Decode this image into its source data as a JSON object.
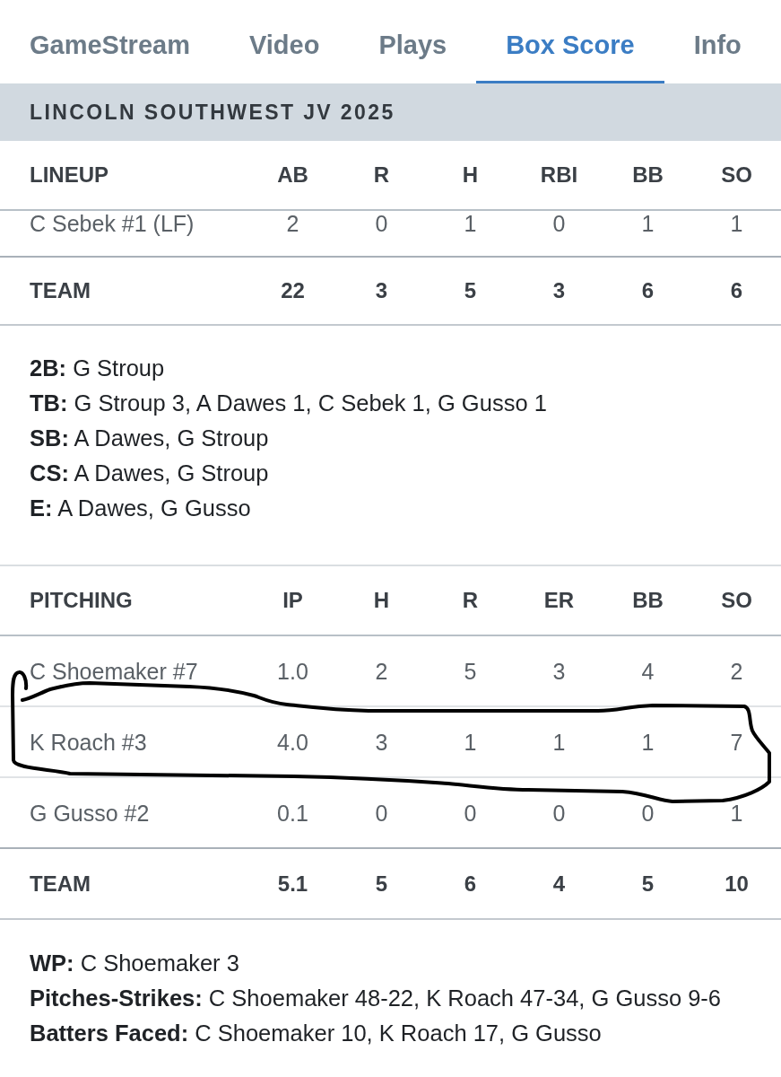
{
  "tabs": [
    {
      "label": "GameStream",
      "selected": false
    },
    {
      "label": "Video",
      "selected": false
    },
    {
      "label": "Plays",
      "selected": false
    },
    {
      "label": "Box Score",
      "selected": true
    },
    {
      "label": "Info",
      "selected": false
    }
  ],
  "team_header": "LINCOLN SOUTHWEST JV 2025",
  "lineup": {
    "columns": [
      "LINEUP",
      "AB",
      "R",
      "H",
      "RBI",
      "BB",
      "SO"
    ],
    "rows": [
      {
        "cells": [
          "C Sebek #1 (LF)",
          "2",
          "0",
          "1",
          "0",
          "1",
          "1"
        ]
      }
    ],
    "total": [
      "TEAM",
      "22",
      "3",
      "5",
      "3",
      "6",
      "6"
    ]
  },
  "batting_notes": [
    "**2B:** G Stroup",
    "**TB:** G Stroup 3, A Dawes 1, C Sebek 1, G Gusso 1",
    "**SB:** A Dawes, G Stroup",
    "**CS:** A Dawes, G Stroup",
    "**E:** A Dawes, G Gusso"
  ],
  "pitching": {
    "columns": [
      "PITCHING",
      "IP",
      "H",
      "R",
      "ER",
      "BB",
      "SO"
    ],
    "rows": [
      {
        "cells": [
          "C Shoemaker #7",
          "1.0",
          "2",
          "5",
          "3",
          "4",
          "2"
        ],
        "circled": false
      },
      {
        "cells": [
          "K Roach #3",
          "4.0",
          "3",
          "1",
          "1",
          "1",
          "7"
        ],
        "circled": true
      },
      {
        "cells": [
          "G Gusso #2",
          "0.1",
          "0",
          "0",
          "0",
          "0",
          "1"
        ],
        "circled": false
      }
    ],
    "total": [
      "TEAM",
      "5.1",
      "5",
      "6",
      "4",
      "5",
      "10"
    ]
  },
  "pitching_notes": [
    "**WP:** C Shoemaker 3",
    "**Pitches-Strikes:** C Shoemaker 48-22, K Roach 47-34, G Gusso 9-6",
    "**Batters Faced:** C Shoemaker 10, K Roach 17, G Gusso"
  ]
}
